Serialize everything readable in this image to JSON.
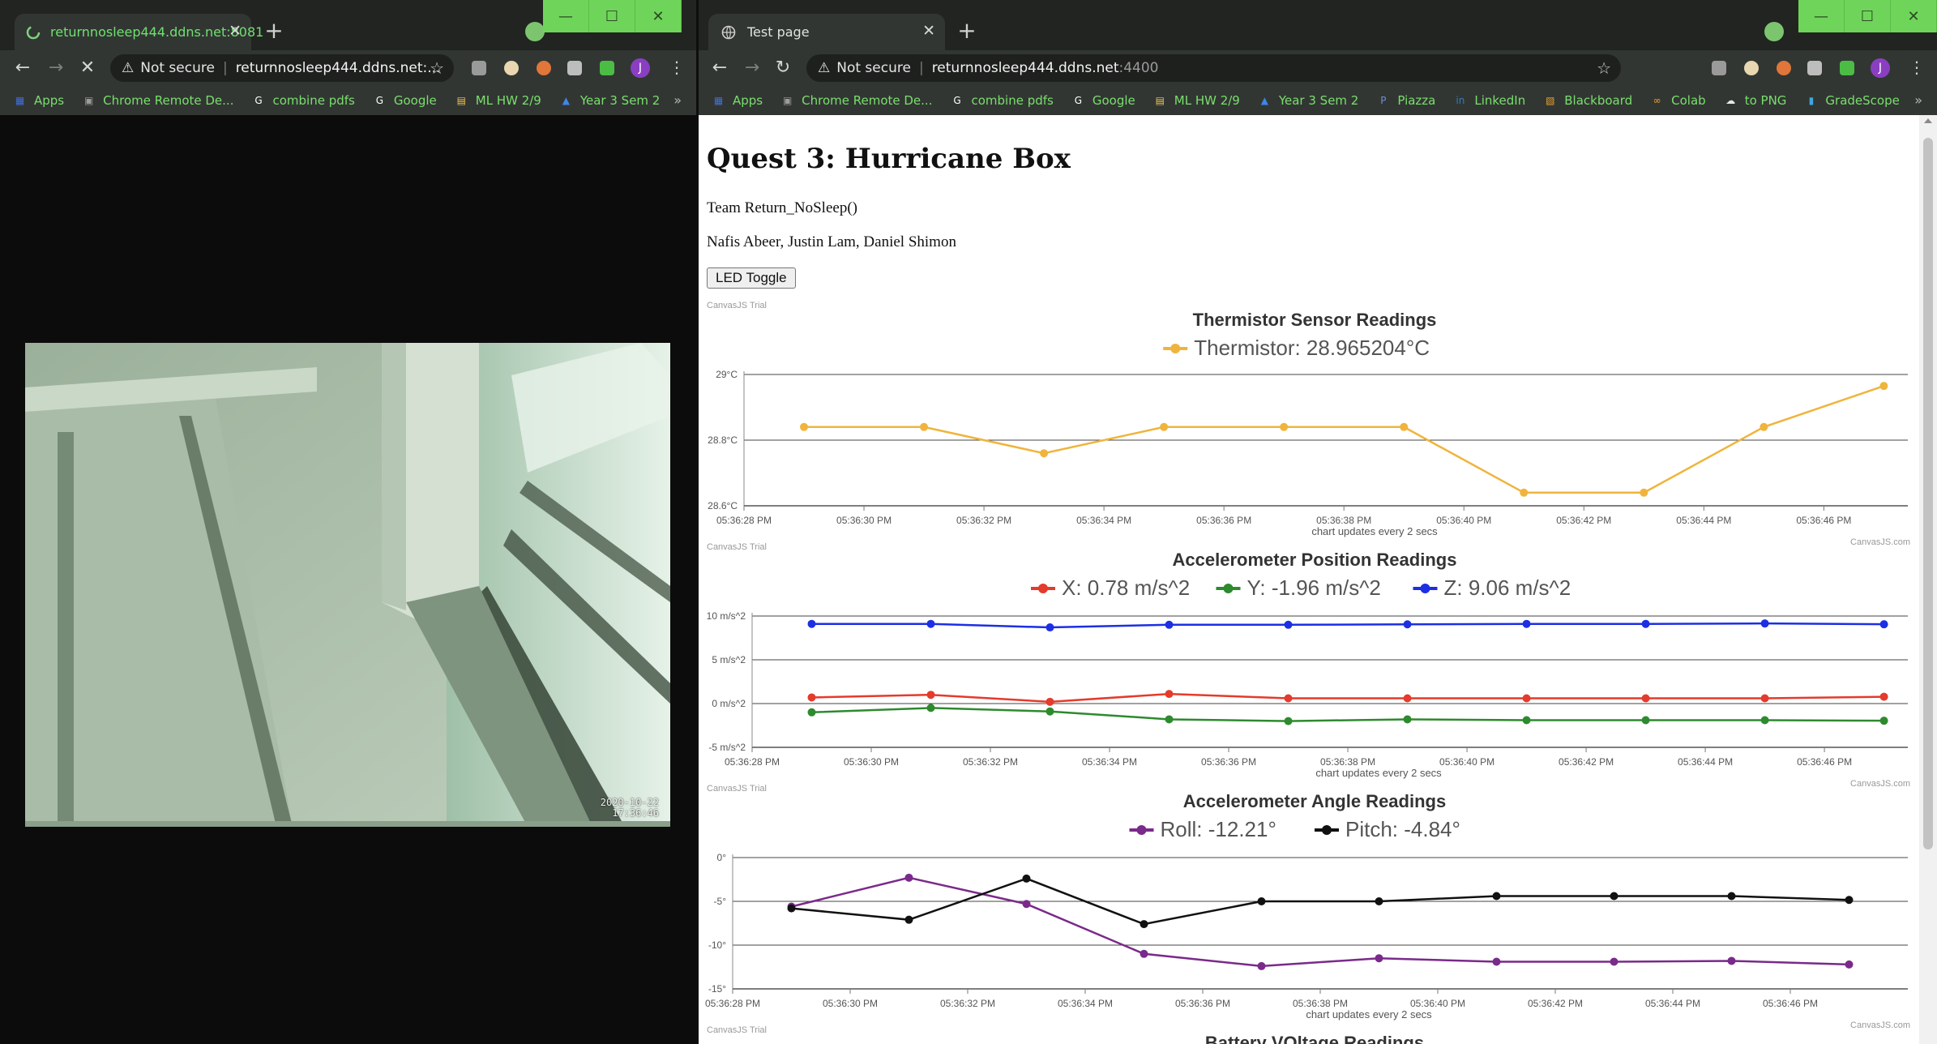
{
  "left_window": {
    "tab_title": "returnnosleep444.ddns.net:8081",
    "omnibox": {
      "security": "Not secure",
      "url": "returnnosleep444.ddns.net:..."
    },
    "bookmarks": [
      {
        "label": "Apps",
        "icon": "apps-grid-icon"
      },
      {
        "label": "Chrome Remote De...",
        "icon": "remote-desktop-icon"
      },
      {
        "label": "combine pdfs",
        "icon": "google-icon"
      },
      {
        "label": "Google",
        "icon": "google-icon"
      },
      {
        "label": "ML HW 2/9",
        "icon": "doc-icon"
      },
      {
        "label": "Year 3 Sem 2",
        "icon": "drive-icon"
      }
    ],
    "video_timestamp": [
      "2020-10-22",
      "17:36:46"
    ],
    "window_controls": [
      "—",
      "☐",
      "✕"
    ]
  },
  "right_window": {
    "tab_title": "Test page",
    "omnibox": {
      "security": "Not secure",
      "url_host": "returnnosleep444.ddns.net",
      "url_port": ":4400"
    },
    "bookmarks": [
      {
        "label": "Apps",
        "icon": "apps-grid-icon"
      },
      {
        "label": "Chrome Remote De...",
        "icon": "remote-desktop-icon"
      },
      {
        "label": "combine pdfs",
        "icon": "google-icon"
      },
      {
        "label": "Google",
        "icon": "google-icon"
      },
      {
        "label": "ML HW 2/9",
        "icon": "doc-icon"
      },
      {
        "label": "Year 3 Sem 2",
        "icon": "drive-icon"
      },
      {
        "label": "Piazza",
        "icon": "piazza-icon"
      },
      {
        "label": "LinkedIn",
        "icon": "linkedin-icon"
      },
      {
        "label": "Blackboard",
        "icon": "blackboard-icon"
      },
      {
        "label": "Colab",
        "icon": "colab-icon"
      },
      {
        "label": "to PNG",
        "icon": "cloud-icon"
      },
      {
        "label": "GradeScope",
        "icon": "bar-chart-icon"
      }
    ],
    "window_controls": [
      "—",
      "☐",
      "✕"
    ]
  },
  "page": {
    "title": "Quest 3: Hurricane Box",
    "team": "Team Return_NoSleep()",
    "members": "Nafis Abeer, Justin Lam, Daniel Shimon",
    "led_button": "LED Toggle",
    "canvasjs_trial": "CanvasJS Trial",
    "canvasjs_credit": "CanvasJS.com",
    "next_chart_title": "Battery VOltage Readings"
  },
  "chart_data": [
    {
      "type": "line",
      "title": "Thermistor Sensor Readings",
      "xlabel": "chart updates every 2 secs",
      "x_ticks": [
        "05:36:28 PM",
        "05:36:30 PM",
        "05:36:32 PM",
        "05:36:34 PM",
        "05:36:36 PM",
        "05:36:38 PM",
        "05:36:40 PM",
        "05:36:42 PM",
        "05:36:44 PM",
        "05:36:46 PM"
      ],
      "x_seconds_range": [
        28,
        47.4
      ],
      "y_ticks": [
        "28.6°C",
        "28.8°C",
        "29°C"
      ],
      "ylim": [
        28.6,
        29.0
      ],
      "grid": true,
      "x_seconds": [
        29,
        31,
        33,
        35,
        37,
        39,
        41,
        43,
        45,
        47
      ],
      "series": [
        {
          "name": "Thermistor",
          "legend": "Thermistor: 28.965204°C",
          "color": "#f0b43c",
          "values": [
            28.84,
            28.84,
            28.76,
            28.84,
            28.84,
            28.84,
            28.64,
            28.64,
            28.84,
            28.965
          ]
        }
      ]
    },
    {
      "type": "line",
      "title": "Accelerometer Position Readings",
      "xlabel": "chart updates every 2 secs",
      "x_ticks": [
        "05:36:28 PM",
        "05:36:30 PM",
        "05:36:32 PM",
        "05:36:34 PM",
        "05:36:36 PM",
        "05:36:38 PM",
        "05:36:40 PM",
        "05:36:42 PM",
        "05:36:44 PM",
        "05:36:46 PM"
      ],
      "x_seconds_range": [
        28,
        47.4
      ],
      "y_ticks": [
        "-5 m/s^2",
        "0 m/s^2",
        "5 m/s^2",
        "10 m/s^2"
      ],
      "ylim": [
        -5,
        10
      ],
      "grid": true,
      "x_seconds": [
        29,
        31,
        33,
        35,
        37,
        39,
        41,
        43,
        45,
        47
      ],
      "series": [
        {
          "name": "X",
          "legend": "X: 0.78 m/s^2",
          "color": "#e43b2c",
          "values": [
            0.7,
            1.0,
            0.2,
            1.1,
            0.6,
            0.6,
            0.6,
            0.6,
            0.6,
            0.78
          ]
        },
        {
          "name": "Y",
          "legend": "Y: -1.96 m/s^2",
          "color": "#2e8a2e",
          "values": [
            -1.0,
            -0.5,
            -0.9,
            -1.8,
            -2.0,
            -1.8,
            -1.9,
            -1.9,
            -1.9,
            -1.96
          ]
        },
        {
          "name": "Z",
          "legend": "Z: 9.06 m/s^2",
          "color": "#1c2fe4",
          "values": [
            9.1,
            9.1,
            8.7,
            9.0,
            9.0,
            9.05,
            9.1,
            9.1,
            9.15,
            9.06
          ]
        }
      ]
    },
    {
      "type": "line",
      "title": "Accelerometer Angle Readings",
      "xlabel": "chart updates every 2 secs",
      "x_ticks": [
        "05:36:28 PM",
        "05:36:30 PM",
        "05:36:32 PM",
        "05:36:34 PM",
        "05:36:36 PM",
        "05:36:38 PM",
        "05:36:40 PM",
        "05:36:42 PM",
        "05:36:44 PM",
        "05:36:46 PM"
      ],
      "x_seconds_range": [
        28,
        48
      ],
      "y_ticks": [
        "-15°",
        "-10°",
        "-5°",
        "0°"
      ],
      "ylim": [
        -15,
        0
      ],
      "grid": true,
      "x_seconds": [
        29,
        31,
        33,
        35,
        37,
        39,
        41,
        43,
        45,
        47
      ],
      "series": [
        {
          "name": "Roll",
          "legend": "Roll: -12.21°",
          "color": "#7a2a8a",
          "values": [
            -5.6,
            -2.3,
            -5.3,
            -11.0,
            -12.4,
            -11.5,
            -11.9,
            -11.9,
            -11.8,
            -12.21
          ]
        },
        {
          "name": "Pitch",
          "legend": "Pitch: -4.84°",
          "color": "#111111",
          "values": [
            -5.8,
            -7.1,
            -2.4,
            -7.6,
            -5.0,
            -5.0,
            -4.4,
            -4.4,
            -4.4,
            -4.84
          ]
        }
      ]
    }
  ]
}
